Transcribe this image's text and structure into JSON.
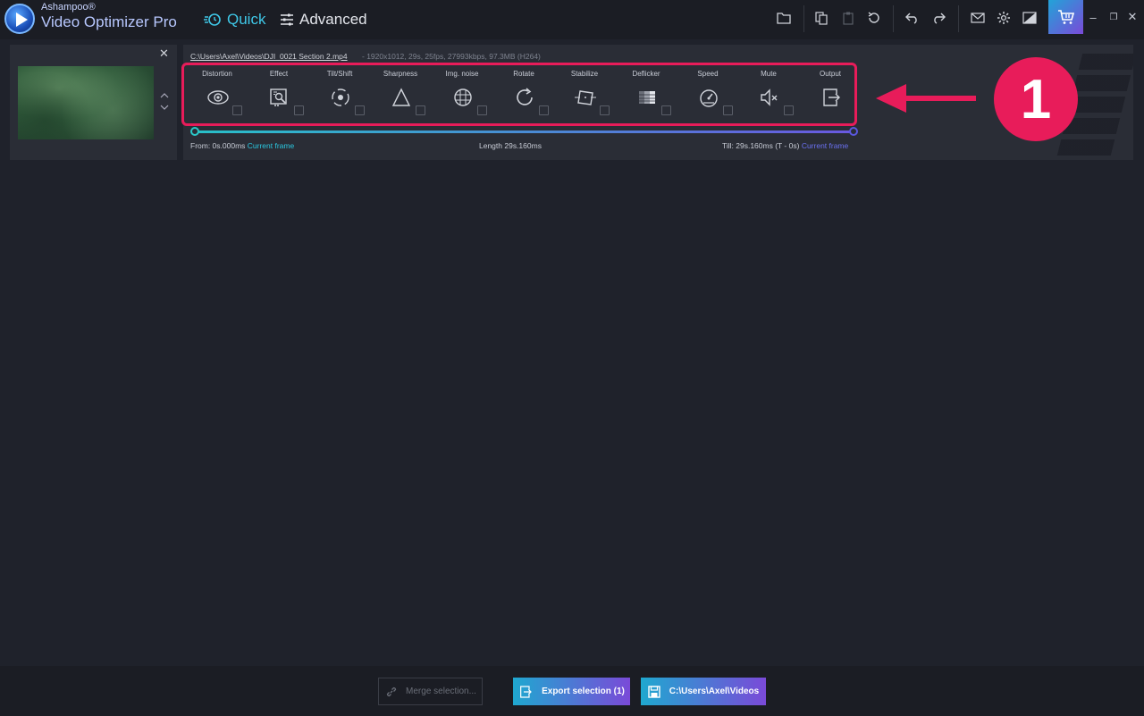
{
  "app": {
    "brand_small": "Ashampoo®",
    "brand_big": "Video Optimizer Pro",
    "modes": {
      "quick": "Quick",
      "advanced": "Advanced"
    }
  },
  "toolbar_icons": [
    "folder-icon",
    "copy-icon",
    "clipboard-icon",
    "reset-icon",
    "undo-icon",
    "redo-icon",
    "mail-icon",
    "settings-icon",
    "compare-icon",
    "cart-icon"
  ],
  "window_controls": {
    "minimize": "–",
    "restore": "❐",
    "close": "✕"
  },
  "item": {
    "file_path": "C:\\Users\\Axel\\Videos\\DJI_0021 Section 2.mp4",
    "file_info": "-   1920x1012, 29s, 25fps, 27993kbps, 97.3MB (H264)",
    "tools": [
      {
        "label": "Distortion",
        "icon": "eye-icon"
      },
      {
        "label": "Effect",
        "icon": "effect-icon"
      },
      {
        "label": "Tilt/Shift",
        "icon": "tilt-shift-icon"
      },
      {
        "label": "Sharpness",
        "icon": "triangle-icon"
      },
      {
        "label": "Img. noise",
        "icon": "noise-icon"
      },
      {
        "label": "Rotate",
        "icon": "rotate-icon"
      },
      {
        "label": "Stabilize",
        "icon": "stabilize-icon"
      },
      {
        "label": "Deflicker",
        "icon": "deflicker-icon"
      },
      {
        "label": "Speed",
        "icon": "speedometer-icon"
      },
      {
        "label": "Mute",
        "icon": "mute-icon"
      },
      {
        "label": "Output",
        "icon": "output-icon"
      }
    ],
    "timeline": {
      "from_label": "From:  0s.000ms",
      "from_link": "Current frame",
      "length_label": "Length  29s.160ms",
      "till_label": "Till:  29s.160ms (T - 0s)",
      "till_link": "Current frame"
    }
  },
  "annotation": {
    "badge": "1",
    "color": "#e81c5a"
  },
  "bottom": {
    "merge": "Merge selection...",
    "export": "Export selection (1)",
    "output_folder": "C:\\Users\\Axel\\Videos"
  },
  "colors": {
    "accent_cyan": "#3fc8e8",
    "gradient_start": "#1fa8d0",
    "gradient_end": "#7a4ad8"
  }
}
